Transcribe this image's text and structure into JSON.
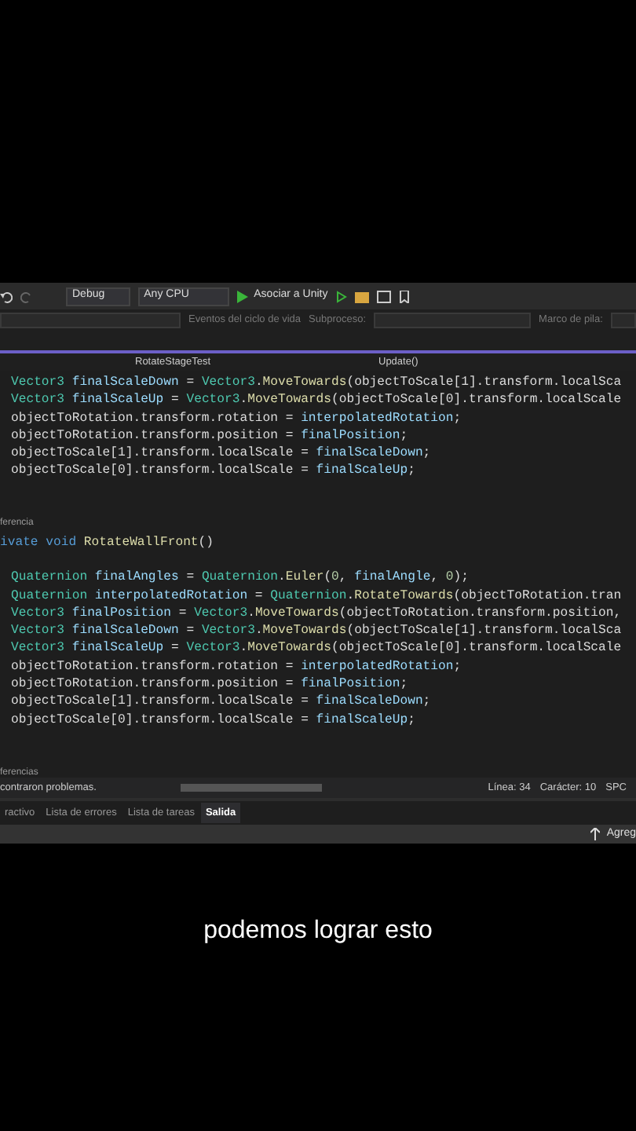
{
  "toolbar": {
    "configuration": "Debug",
    "platform": "Any CPU",
    "run_label": "Asociar a Unity"
  },
  "debug_bar": {
    "lifecycle": "Eventos del ciclo de vida",
    "thread_label": "Subproceso:",
    "stack_label": "Marco de pila:"
  },
  "nav_bar": {
    "class": "RotateStageTest",
    "member": "Update()"
  },
  "code": [
    {
      "kind": "statement",
      "spans": [
        {
          "text": "Vector3",
          "kind": "type"
        },
        {
          "text": " finalScaleDown",
          "kind": "local"
        },
        {
          "text": " = ",
          "kind": "plain"
        },
        {
          "text": "Vector3",
          "kind": "type"
        },
        {
          "text": ".",
          "kind": "plain"
        },
        {
          "text": "MoveTowards",
          "kind": "method"
        },
        {
          "text": "(objectToScale[1].transform.localSca",
          "kind": "plain"
        }
      ]
    },
    {
      "kind": "statement",
      "spans": [
        {
          "text": "Vector3",
          "kind": "type"
        },
        {
          "text": " finalScaleUp",
          "kind": "local"
        },
        {
          "text": " = ",
          "kind": "plain"
        },
        {
          "text": "Vector3",
          "kind": "type"
        },
        {
          "text": ".",
          "kind": "plain"
        },
        {
          "text": "MoveTowards",
          "kind": "method"
        },
        {
          "text": "(objectToScale[0].transform.localScale",
          "kind": "plain"
        }
      ]
    },
    {
      "kind": "statement",
      "spans": [
        {
          "text": "objectToRotation.transform.rotation = ",
          "kind": "plain"
        },
        {
          "text": "interpolatedRotation",
          "kind": "local"
        },
        {
          "text": ";",
          "kind": "plain"
        }
      ]
    },
    {
      "kind": "statement",
      "spans": [
        {
          "text": "objectToRotation.transform.position = ",
          "kind": "plain"
        },
        {
          "text": "finalPosition",
          "kind": "local"
        },
        {
          "text": ";",
          "kind": "plain"
        }
      ]
    },
    {
      "kind": "statement",
      "spans": [
        {
          "text": "objectToScale[1].transform.localScale = ",
          "kind": "plain"
        },
        {
          "text": "finalScaleDown",
          "kind": "local"
        },
        {
          "text": ";",
          "kind": "plain"
        }
      ]
    },
    {
      "kind": "statement",
      "spans": [
        {
          "text": "objectToScale[0].transform.localScale = ",
          "kind": "plain"
        },
        {
          "text": "finalScaleUp",
          "kind": "local"
        },
        {
          "text": ";",
          "kind": "plain"
        }
      ]
    },
    {
      "kind": "blank"
    },
    {
      "kind": "blank"
    },
    {
      "kind": "lens",
      "text": "ferencia"
    },
    {
      "kind": "declaration",
      "spans": [
        {
          "text": "ivate void",
          "kind": "kw"
        },
        {
          "text": " RotateWallFront",
          "kind": "method"
        },
        {
          "text": "()",
          "kind": "plain"
        }
      ]
    },
    {
      "kind": "blank"
    },
    {
      "kind": "statement",
      "spans": [
        {
          "text": "Quaternion",
          "kind": "type"
        },
        {
          "text": " finalAngles",
          "kind": "local"
        },
        {
          "text": " = ",
          "kind": "plain"
        },
        {
          "text": "Quaternion",
          "kind": "type"
        },
        {
          "text": ".",
          "kind": "plain"
        },
        {
          "text": "Euler",
          "kind": "method"
        },
        {
          "text": "(",
          "kind": "plain"
        },
        {
          "text": "0",
          "kind": "num"
        },
        {
          "text": ", ",
          "kind": "plain"
        },
        {
          "text": "finalAngle",
          "kind": "local"
        },
        {
          "text": ", ",
          "kind": "plain"
        },
        {
          "text": "0",
          "kind": "num"
        },
        {
          "text": ");",
          "kind": "plain"
        }
      ]
    },
    {
      "kind": "statement",
      "spans": [
        {
          "text": "Quaternion",
          "kind": "type"
        },
        {
          "text": " interpolatedRotation",
          "kind": "local"
        },
        {
          "text": " = ",
          "kind": "plain"
        },
        {
          "text": "Quaternion",
          "kind": "type"
        },
        {
          "text": ".",
          "kind": "plain"
        },
        {
          "text": "RotateTowards",
          "kind": "method"
        },
        {
          "text": "(objectToRotation.tran",
          "kind": "plain"
        }
      ]
    },
    {
      "kind": "statement",
      "spans": [
        {
          "text": "Vector3",
          "kind": "type"
        },
        {
          "text": " finalPosition",
          "kind": "local"
        },
        {
          "text": " = ",
          "kind": "plain"
        },
        {
          "text": "Vector3",
          "kind": "type"
        },
        {
          "text": ".",
          "kind": "plain"
        },
        {
          "text": "MoveTowards",
          "kind": "method"
        },
        {
          "text": "(objectToRotation.transform.position,",
          "kind": "plain"
        }
      ]
    },
    {
      "kind": "statement",
      "spans": [
        {
          "text": "Vector3",
          "kind": "type"
        },
        {
          "text": " finalScaleDown",
          "kind": "local"
        },
        {
          "text": " = ",
          "kind": "plain"
        },
        {
          "text": "Vector3",
          "kind": "type"
        },
        {
          "text": ".",
          "kind": "plain"
        },
        {
          "text": "MoveTowards",
          "kind": "method"
        },
        {
          "text": "(objectToScale[1].transform.localSca",
          "kind": "plain"
        }
      ]
    },
    {
      "kind": "statement",
      "spans": [
        {
          "text": "Vector3",
          "kind": "type"
        },
        {
          "text": " finalScaleUp",
          "kind": "local"
        },
        {
          "text": " = ",
          "kind": "plain"
        },
        {
          "text": "Vector3",
          "kind": "type"
        },
        {
          "text": ".",
          "kind": "plain"
        },
        {
          "text": "MoveTowards",
          "kind": "method"
        },
        {
          "text": "(objectToScale[0].transform.localScale",
          "kind": "plain"
        }
      ]
    },
    {
      "kind": "statement",
      "spans": [
        {
          "text": "objectToRotation.transform.rotation = ",
          "kind": "plain"
        },
        {
          "text": "interpolatedRotation",
          "kind": "local"
        },
        {
          "text": ";",
          "kind": "plain"
        }
      ]
    },
    {
      "kind": "statement",
      "spans": [
        {
          "text": "objectToRotation.transform.position = ",
          "kind": "plain"
        },
        {
          "text": "finalPosition",
          "kind": "local"
        },
        {
          "text": ";",
          "kind": "plain"
        }
      ]
    },
    {
      "kind": "statement",
      "spans": [
        {
          "text": "objectToScale[1].transform.localScale = ",
          "kind": "plain"
        },
        {
          "text": "finalScaleDown",
          "kind": "local"
        },
        {
          "text": ";",
          "kind": "plain"
        }
      ]
    },
    {
      "kind": "statement",
      "spans": [
        {
          "text": "objectToScale[0].transform.localScale = ",
          "kind": "plain"
        },
        {
          "text": "finalScaleUp",
          "kind": "local"
        },
        {
          "text": ";",
          "kind": "plain"
        }
      ]
    },
    {
      "kind": "blank"
    },
    {
      "kind": "blank"
    },
    {
      "kind": "lens",
      "text": "ferencias"
    }
  ],
  "status_bar": {
    "issues": "contraron problemas.",
    "line": "Línea: 34",
    "column": "Carácter: 10",
    "spacing": "SPC"
  },
  "panel_tabs": [
    {
      "label": "ractivo",
      "selected": false
    },
    {
      "label": "Lista de errores",
      "selected": false
    },
    {
      "label": "Lista de tareas",
      "selected": false
    },
    {
      "label": "Salida",
      "selected": true
    }
  ],
  "bottom_bar": {
    "action": "Agreg"
  },
  "caption": "podemos lograr esto"
}
